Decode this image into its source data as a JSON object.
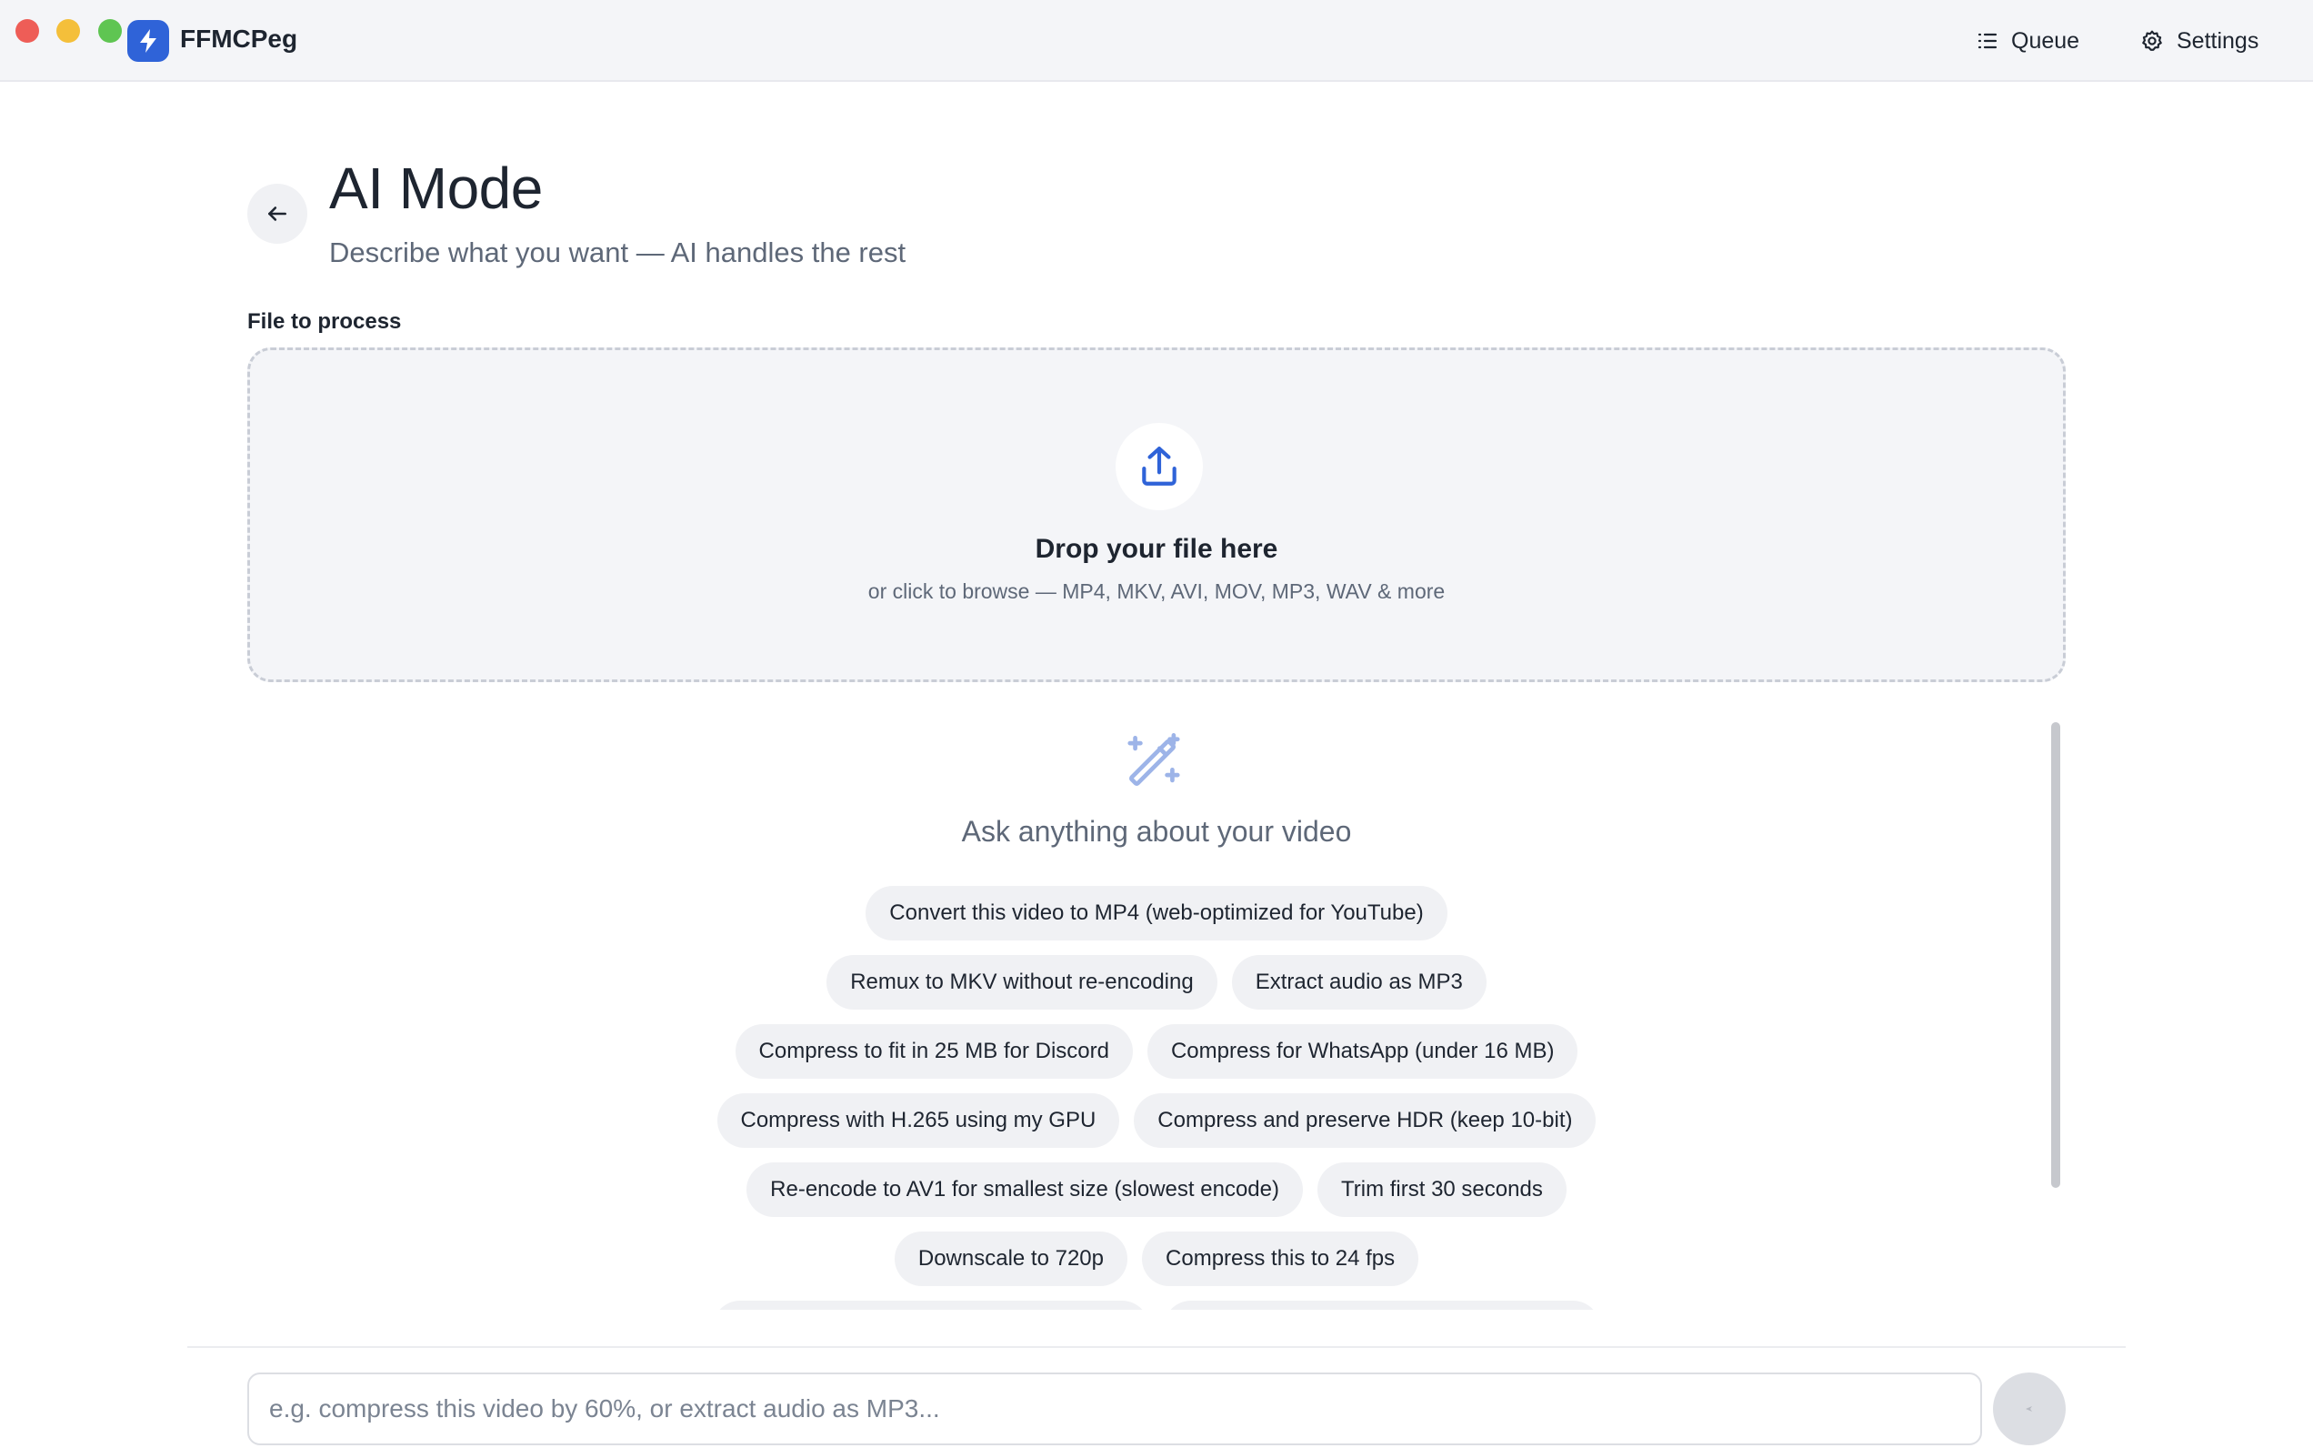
{
  "app": {
    "name": "FFMCPeg"
  },
  "toolbar": {
    "queue_label": "Queue",
    "settings_label": "Settings"
  },
  "header": {
    "title": "AI Mode",
    "subtitle": "Describe what you want — AI handles the rest"
  },
  "file_section": {
    "label": "File to process",
    "drop_title": "Drop your file here",
    "drop_subtitle": "or click to browse — MP4, MKV, AVI, MOV, MP3, WAV & more"
  },
  "suggestions": {
    "title": "Ask anything about your video",
    "rows": [
      [
        "Convert this video to MP4 (web-optimized for YouTube)"
      ],
      [
        "Remux to MKV without re-encoding",
        "Extract audio as MP3"
      ],
      [
        "Compress to fit in 25 MB for Discord",
        "Compress for WhatsApp (under 16 MB)"
      ],
      [
        "Compress with H.265 using my GPU",
        "Compress and preserve HDR (keep 10-bit)"
      ],
      [
        "Re-encode to AV1 for smallest size (slowest encode)",
        "Trim first 30 seconds"
      ],
      [
        "Downscale to 720p",
        "Compress this to 24 fps"
      ]
    ]
  },
  "prompt": {
    "placeholder": "e.g. compress this video by 60%, or extract audio as MP3..."
  },
  "colors": {
    "accent": "#2f63d8",
    "chip_bg": "#f0f1f4",
    "muted_text": "#5e6878"
  }
}
